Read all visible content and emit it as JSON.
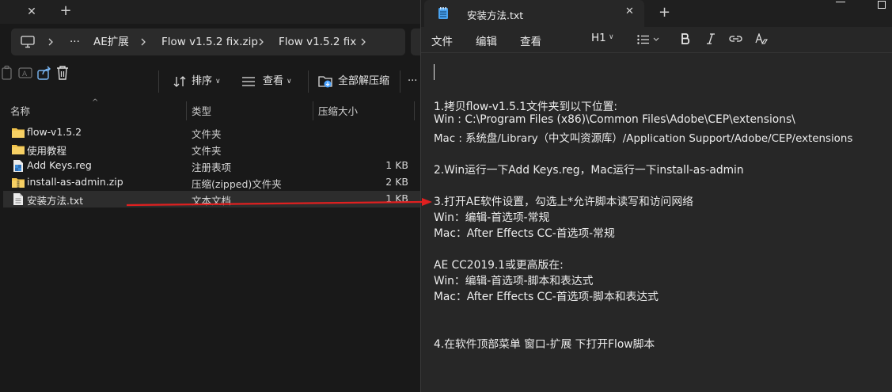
{
  "explorer": {
    "breadcrumb": {
      "overflow_label": "···",
      "items": [
        "AE扩展",
        "Flow v1.5.2 fix.zip",
        "Flow v1.5.2 fix"
      ]
    },
    "toolbar": {
      "sort_label": "排序",
      "view_label": "查看",
      "extract_all_label": "全部解压缩",
      "more_label": "···"
    },
    "columns": {
      "name": "名称",
      "type": "类型",
      "compressed_size": "压缩大小"
    },
    "files": [
      {
        "name": "flow-v1.5.2",
        "type": "文件夹",
        "size": "",
        "icon": "folder-icon"
      },
      {
        "name": "使用教程",
        "type": "文件夹",
        "size": "",
        "icon": "folder-icon"
      },
      {
        "name": "Add Keys.reg",
        "type": "注册表项",
        "size": "1 KB",
        "icon": "registry-file-icon"
      },
      {
        "name": "install-as-admin.zip",
        "type": "压缩(zipped)文件夹",
        "size": "2 KB",
        "icon": "zip-folder-icon"
      },
      {
        "name": "安装方法.txt",
        "type": "文本文档",
        "size": "1 KB",
        "icon": "text-file-icon",
        "selected": true
      }
    ]
  },
  "notepad": {
    "tab_title": "安装方法.txt",
    "menu": {
      "file": "文件",
      "edit": "编辑",
      "view": "查看"
    },
    "format": {
      "heading_label": "H1"
    },
    "lines": [
      "1.拷贝flow-v1.5.1文件夹到以下位置:",
      "Win : C:\\Program Files (x86)\\Common Files\\Adobe\\CEP\\extensions\\",
      "Mac : 系统盘/Library（中文叫资源库）/Application Support/Adobe/CEP/extensions",
      "2.Win运行一下Add Keys.reg，Mac运行一下install-as-admin",
      "3.打开AE软件设置，勾选上*允许脚本读写和访问网络",
      "Win：编辑-首选项-常规",
      "Mac：After Effects CC-首选项-常规",
      "AE CC2019.1或更高版在:",
      "Win：编辑-首选项-脚本和表达式",
      "Mac：After Effects CC-首选项-脚本和表达式",
      "4.在软件顶部菜单 窗口-扩展 下打开Flow脚本"
    ]
  },
  "colors": {
    "explorer_bg": "#191919",
    "notepad_bg": "#272727",
    "arrow": "#e02020",
    "folder": "#f0c24b"
  }
}
